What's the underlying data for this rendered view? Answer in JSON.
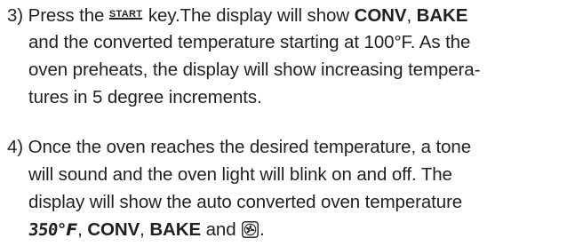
{
  "steps": [
    {
      "lines": [
        {
          "parts": [
            "3) Press the ",
            "START",
            " key.The display will show ",
            "CONV",
            ", ",
            "BAKE"
          ]
        },
        {
          "text": "and the converted temperature starting at 100°F. As the"
        },
        {
          "text": "oven preheats, the display will show increasing tempera-"
        },
        {
          "text": "tures in 5 degree increments."
        }
      ]
    },
    {
      "lines": [
        {
          "text": "4) Once the oven reaches the desired temperature, a tone"
        },
        {
          "text": "will sound and the oven light will blink on and off. The"
        },
        {
          "text": "display will show the auto converted oven temperature"
        },
        {
          "parts": [
            "350",
            "°F",
            ", ",
            "CONV",
            ", ",
            "BAKE",
            " and ",
            "."
          ]
        }
      ]
    }
  ],
  "icons": {
    "convection_fan": "convection-fan-icon"
  }
}
